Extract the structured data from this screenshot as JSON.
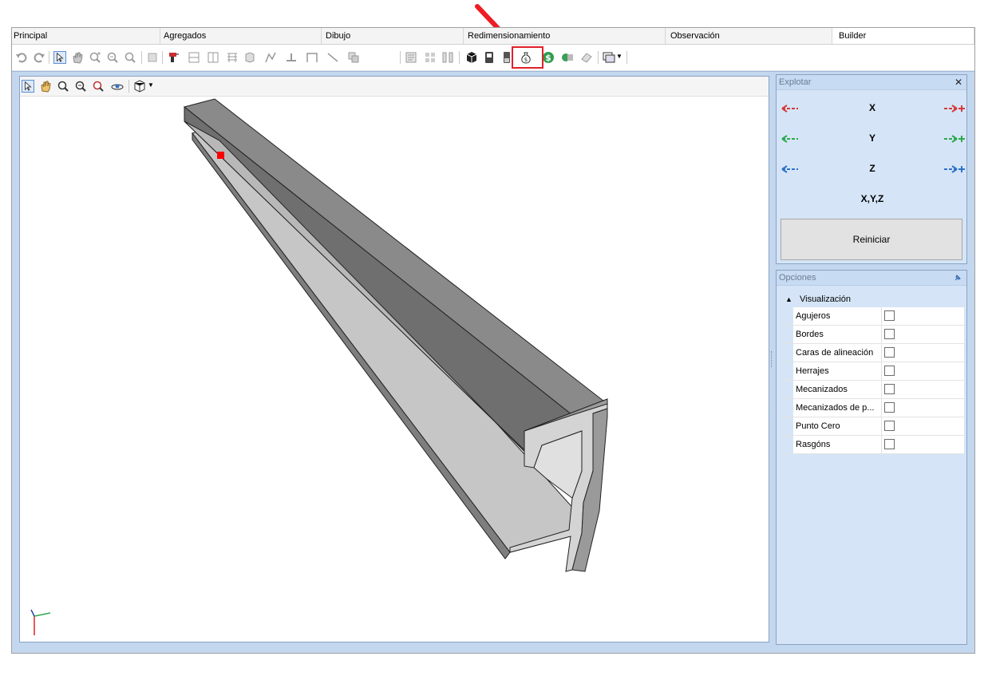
{
  "tabs": [
    {
      "label": "Principal",
      "active": false
    },
    {
      "label": "Agregados",
      "active": false
    },
    {
      "label": "Dibujo",
      "active": false
    },
    {
      "label": "Redimensionamiento",
      "active": false
    },
    {
      "label": "Observación",
      "active": false
    },
    {
      "label": "Builder",
      "active": true
    }
  ],
  "explotar": {
    "title": "Explotar",
    "close": "✕",
    "axes": [
      {
        "label": "X",
        "color": "#d63a3a"
      },
      {
        "label": "Y",
        "color": "#2fa84f"
      },
      {
        "label": "Z",
        "color": "#2f72c8"
      },
      {
        "label": "X,Y,Z",
        "color": "#000000"
      }
    ],
    "reset_label": "Reiniciar"
  },
  "opciones": {
    "title": "Opciones",
    "category": "Visualización",
    "properties": [
      {
        "name": "Agujeros",
        "checked": false
      },
      {
        "name": "Bordes",
        "checked": false
      },
      {
        "name": "Caras de alineación",
        "checked": false
      },
      {
        "name": "Herrajes",
        "checked": false
      },
      {
        "name": "Mecanizados",
        "checked": false
      },
      {
        "name": "Mecanizados de p...",
        "checked": false
      },
      {
        "name": "Punto Cero",
        "checked": false
      },
      {
        "name": "Rasgóns",
        "checked": false
      }
    ]
  },
  "colors": {
    "highlight": "#e0202a",
    "annotation_arrow": "#ee1c24"
  }
}
